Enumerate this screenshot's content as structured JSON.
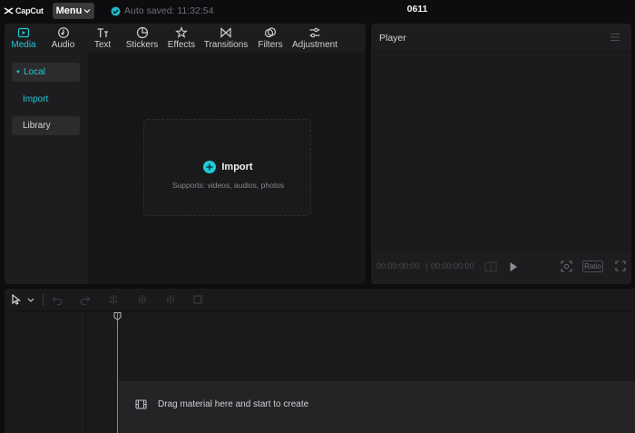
{
  "app": {
    "logo_text": "CapCut",
    "menu_label": "Menu",
    "autosave_text": "Auto saved: 11:32:54",
    "project_name": "0611"
  },
  "media_panel": {
    "tabs": [
      {
        "label": "Media",
        "icon": "media-icon",
        "active": true
      },
      {
        "label": "Audio",
        "icon": "audio-icon",
        "active": false
      },
      {
        "label": "Text",
        "icon": "text-icon",
        "active": false
      },
      {
        "label": "Stickers",
        "icon": "sticker-icon",
        "active": false
      },
      {
        "label": "Effects",
        "icon": "effects-icon",
        "active": false
      },
      {
        "label": "Transitions",
        "icon": "transitions-icon",
        "active": false
      },
      {
        "label": "Filters",
        "icon": "filters-icon",
        "active": false
      },
      {
        "label": "Adjustment",
        "icon": "adjustment-icon",
        "active": false
      }
    ],
    "sidebar": {
      "local": "Local",
      "import": "Import",
      "library": "Library"
    },
    "import_box": {
      "label": "Import",
      "supports": "Supports: videos, audios, photos"
    }
  },
  "player": {
    "title": "Player",
    "time_current": "00:00:00:00",
    "time_separator": "|",
    "time_total": "00:00:00:00",
    "ratio_label": "Ratio"
  },
  "timeline": {
    "drop_hint": "Drag material here and start to create"
  },
  "colors": {
    "accent": "#22c9d6",
    "background": "#0d0d0f",
    "panel": "#1d1d1f"
  }
}
